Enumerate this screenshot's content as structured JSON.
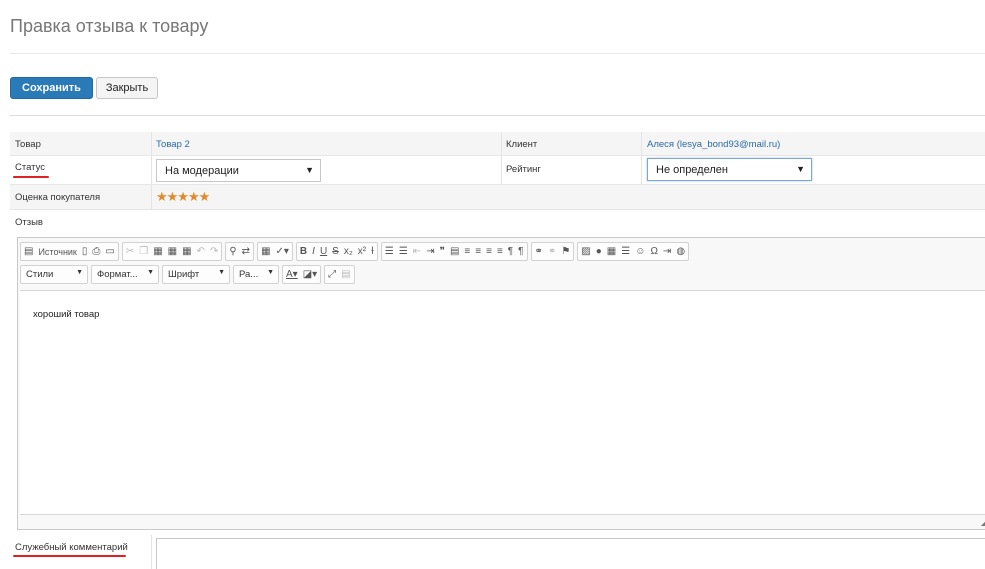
{
  "page": {
    "title": "Правка отзыва к товару"
  },
  "toolbar": {
    "save_label": "Сохранить",
    "close_label": "Закрыть"
  },
  "form": {
    "product_label": "Товар",
    "product_value": "Товар 2",
    "client_label": "Клиент",
    "client_value": "Алеся (lesya_bond93@mail.ru)",
    "status_label": "Статус",
    "status_value": "На модерации",
    "rating_label": "Рейтинг",
    "rating_value": "Не определен",
    "buyer_rating_label": "Оценка покупателя",
    "buyer_rating_stars": "★★★★★",
    "buyer_rating_value": 5,
    "review_label": "Отзыв",
    "service_comment_label": "Служебный комментарий",
    "service_comment_value": ""
  },
  "editor": {
    "source_label": "Источник",
    "styles_label": "Стили",
    "format_label": "Формат...",
    "font_label": "Шрифт",
    "size_label": "Ра...",
    "content": "хороший товар"
  },
  "colors": {
    "accent": "#2a7ab7",
    "link": "#2b6aa6",
    "highlight": "#e02020",
    "star": "#e3892b"
  }
}
